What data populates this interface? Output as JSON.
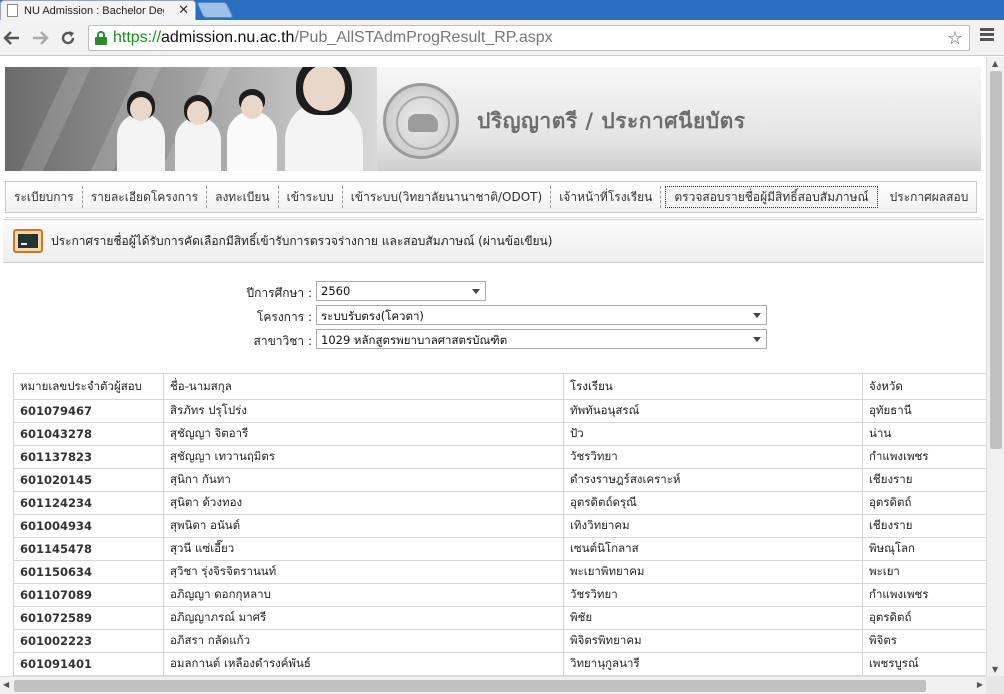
{
  "browser": {
    "tab_title": "NU Admission : Bachelor Degree",
    "tab_close": "✕",
    "url_scheme": "https://",
    "url_host": "admission.nu.ac.th",
    "url_path": "/Pub_AllSTAdmProgResult_RP.aspx"
  },
  "banner": {
    "title": "ปริญญาตรี / ประกาศนียบัตร"
  },
  "menu": {
    "items": [
      "ระเบียบการ",
      "รายละเอียดโครงการ",
      "ลงทะเบียน",
      "เข้าระบบ",
      "เข้าระบบ(วิทยาลัยนานาชาติ/ODOT)",
      "เจ้าหน้าที่โรงเรียน",
      "ตรวจสอบรายชื่อผู้มีสิทธิ์สอบสัมภาษณ์",
      "ประกาศผลสอบ"
    ],
    "active_index": 6
  },
  "section": {
    "title": "ประกาศรายชื่อผู้ได้รับการคัดเลือกมีสิทธิ์เข้ารับการตรวจร่างกาย และสอบสัมภาษณ์ (ผ่านข้อเขียน)"
  },
  "form": {
    "year_label": "ปีการศึกษา :",
    "year_value": "2560",
    "project_label": "โครงการ :",
    "project_value": "ระบบรับตรง(โควตา)",
    "major_label": "สาขาวิชา :",
    "major_value": "1029 หลักสูตรพยาบาลศาสตรบัณฑิต"
  },
  "table": {
    "headers": [
      "หมายเลขประจำตัวผู้สอบ",
      "ชื่อ-นามสกุล",
      "โรงเรียน",
      "จังหวัด"
    ],
    "rows": [
      [
        "601079467",
        "สิรภัทร ปรุโปร่ง",
        "ทัพทันอนุสรณ์",
        "อุทัยธานี"
      ],
      [
        "601043278",
        "สุชัญญา จิตอารี",
        "ปัว",
        "น่าน"
      ],
      [
        "601137823",
        "สุชัญญา เทวานฤมิตร",
        "วัชรวิทยา",
        "กำแพงเพชร"
      ],
      [
        "601020145",
        "สุนิกา กันทา",
        "ดำรงราษฎร์สงเคราะห์",
        "เชียงราย"
      ],
      [
        "601124234",
        "สุนิตา ด้วงทอง",
        "อุตรดิตถ์ดรุณี",
        "อุตรดิตถ์"
      ],
      [
        "601004934",
        "สุพนิดา อนันต์",
        "เทิงวิทยาคม",
        "เชียงราย"
      ],
      [
        "601145478",
        "สุวนี แซ่เอี๊ยว",
        "เซนต์นิโกลาส",
        "พิษณุโลก"
      ],
      [
        "601150634",
        "สุวิชา รุ่งจิรจิตรานนท์",
        "พะเยาพิทยาคม",
        "พะเยา"
      ],
      [
        "601107089",
        "อภิญญา ดอกกุหลาบ",
        "วัชรวิทยา",
        "กำแพงเพชร"
      ],
      [
        "601072589",
        "อภิญญาภรณ์ มาศรี",
        "พิชัย",
        "อุตรดิตถ์"
      ],
      [
        "601002223",
        "อภิสรา กลัดแก้ว",
        "พิจิตรพิทยาคม",
        "พิจิตร"
      ],
      [
        "601091401",
        "อมลกานต์ เหลืองดำรงค์พันธ์",
        "วิทยานุกูลนารี",
        "เพชรบูรณ์"
      ]
    ]
  }
}
